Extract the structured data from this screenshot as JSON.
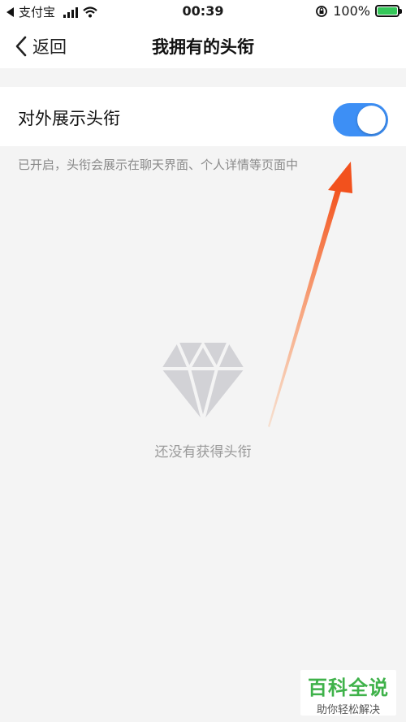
{
  "status_bar": {
    "carrier": "支付宝",
    "time": "00:39",
    "battery": "100%"
  },
  "nav": {
    "back_label": "返回",
    "title": "我拥有的头衔"
  },
  "setting": {
    "label": "对外展示头衔",
    "enabled": true,
    "hint": "已开启，头衔会展示在聊天界面、个人详情等页面中"
  },
  "empty_state": {
    "icon": "diamond-icon",
    "text": "还没有获得头衔"
  },
  "watermark": {
    "title": "百科全说",
    "subtitle": "助你轻松解决"
  },
  "colors": {
    "toggle_on": "#3d8ff5",
    "annotation_arrow": "#f2511d",
    "watermark_green": "#3fb24a"
  }
}
